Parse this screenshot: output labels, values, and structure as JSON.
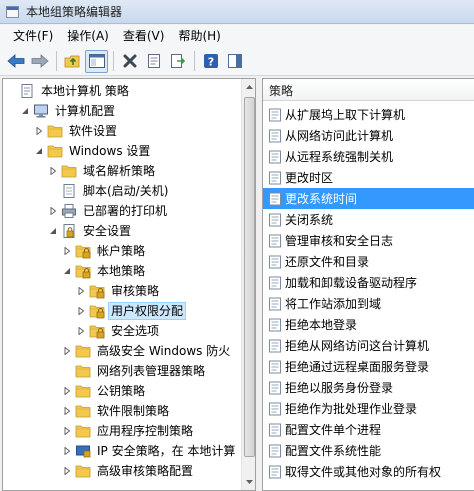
{
  "window": {
    "title": "本地组策略编辑器"
  },
  "menu": [
    {
      "label": "文件(F)"
    },
    {
      "label": "操作(A)"
    },
    {
      "label": "查看(V)"
    },
    {
      "label": "帮助(H)"
    }
  ],
  "toolbar": [
    {
      "name": "back-button",
      "icon": "back-arrow-icon",
      "color": "#3a78c8"
    },
    {
      "name": "forward-button",
      "icon": "forward-arrow-icon",
      "color": "#8a9aab"
    },
    {
      "name": "up-folder-button",
      "icon": "up-folder-icon",
      "color": "#e0b24a"
    },
    {
      "name": "show-hide-tree-button",
      "icon": "console-tree-icon",
      "color": "#6d7e95"
    },
    {
      "name": "delete-button",
      "icon": "delete-icon",
      "color": "#505a66"
    },
    {
      "name": "properties-button",
      "icon": "properties-icon",
      "color": "#6d7e95"
    },
    {
      "name": "export-list-button",
      "icon": "export-icon",
      "color": "#3d9b3d"
    },
    {
      "name": "help-button",
      "icon": "help-icon",
      "color": "#2d5fae"
    },
    {
      "name": "show-pane-button",
      "icon": "pane-icon",
      "color": "#4a6f9e"
    }
  ],
  "tree": [
    {
      "label": "本地计算机 策略",
      "level": 0,
      "toggle": "none",
      "icon": "policy-scroll-icon"
    },
    {
      "label": "计算机配置",
      "level": 1,
      "toggle": "expanded",
      "icon": "computer-icon"
    },
    {
      "label": "软件设置",
      "level": 2,
      "toggle": "collapsed",
      "icon": "folder-icon"
    },
    {
      "label": "Windows 设置",
      "level": 2,
      "toggle": "expanded",
      "icon": "folder-icon"
    },
    {
      "label": "域名解析策略",
      "level": 3,
      "toggle": "collapsed",
      "icon": "folder-icon"
    },
    {
      "label": "脚本(启动/关机)",
      "level": 3,
      "toggle": "none",
      "icon": "script-icon"
    },
    {
      "label": "已部署的打印机",
      "level": 3,
      "toggle": "collapsed",
      "icon": "printer-icon"
    },
    {
      "label": "安全设置",
      "level": 3,
      "toggle": "expanded",
      "icon": "security-icon"
    },
    {
      "label": "帐户策略",
      "level": 4,
      "toggle": "collapsed",
      "icon": "locked-folder-icon"
    },
    {
      "label": "本地策略",
      "level": 4,
      "toggle": "expanded",
      "icon": "locked-folder-icon"
    },
    {
      "label": "审核策略",
      "level": 5,
      "toggle": "collapsed",
      "icon": "locked-folder-icon"
    },
    {
      "label": "用户权限分配",
      "level": 5,
      "toggle": "collapsed",
      "icon": "locked-folder-icon",
      "selected": true
    },
    {
      "label": "安全选项",
      "level": 5,
      "toggle": "collapsed",
      "icon": "locked-folder-icon"
    },
    {
      "label": "高级安全 Windows 防火",
      "level": 4,
      "toggle": "collapsed",
      "icon": "folder-icon"
    },
    {
      "label": "网络列表管理器策略",
      "level": 4,
      "toggle": "none",
      "icon": "folder-icon"
    },
    {
      "label": "公钥策略",
      "level": 4,
      "toggle": "collapsed",
      "icon": "folder-icon"
    },
    {
      "label": "软件限制策略",
      "level": 4,
      "toggle": "collapsed",
      "icon": "folder-icon"
    },
    {
      "label": "应用程序控制策略",
      "level": 4,
      "toggle": "collapsed",
      "icon": "folder-icon"
    },
    {
      "label": "IP 安全策略，在 本地计算",
      "level": 4,
      "toggle": "collapsed",
      "icon": "ipsec-icon"
    },
    {
      "label": "高级审核策略配置",
      "level": 4,
      "toggle": "collapsed",
      "icon": "folder-icon"
    }
  ],
  "list": {
    "header": "策略",
    "items": [
      {
        "label": "从扩展坞上取下计算机"
      },
      {
        "label": "从网络访问此计算机"
      },
      {
        "label": "从远程系统强制关机"
      },
      {
        "label": "更改时区"
      },
      {
        "label": "更改系统时间",
        "selected": true
      },
      {
        "label": "关闭系统"
      },
      {
        "label": "管理审核和安全日志"
      },
      {
        "label": "还原文件和目录"
      },
      {
        "label": "加载和卸载设备驱动程序"
      },
      {
        "label": "将工作站添加到域"
      },
      {
        "label": "拒绝本地登录"
      },
      {
        "label": "拒绝从网络访问这台计算机"
      },
      {
        "label": "拒绝通过远程桌面服务登录"
      },
      {
        "label": "拒绝以服务身份登录"
      },
      {
        "label": "拒绝作为批处理作业登录"
      },
      {
        "label": "配置文件单个进程"
      },
      {
        "label": "配置文件系统性能"
      },
      {
        "label": "取得文件或其他对象的所有权"
      }
    ]
  },
  "colors": {
    "selection": "#3399ff",
    "tree_selection": "#cce8ff",
    "folder": "#f2c94c",
    "lock": "#d9a521"
  }
}
